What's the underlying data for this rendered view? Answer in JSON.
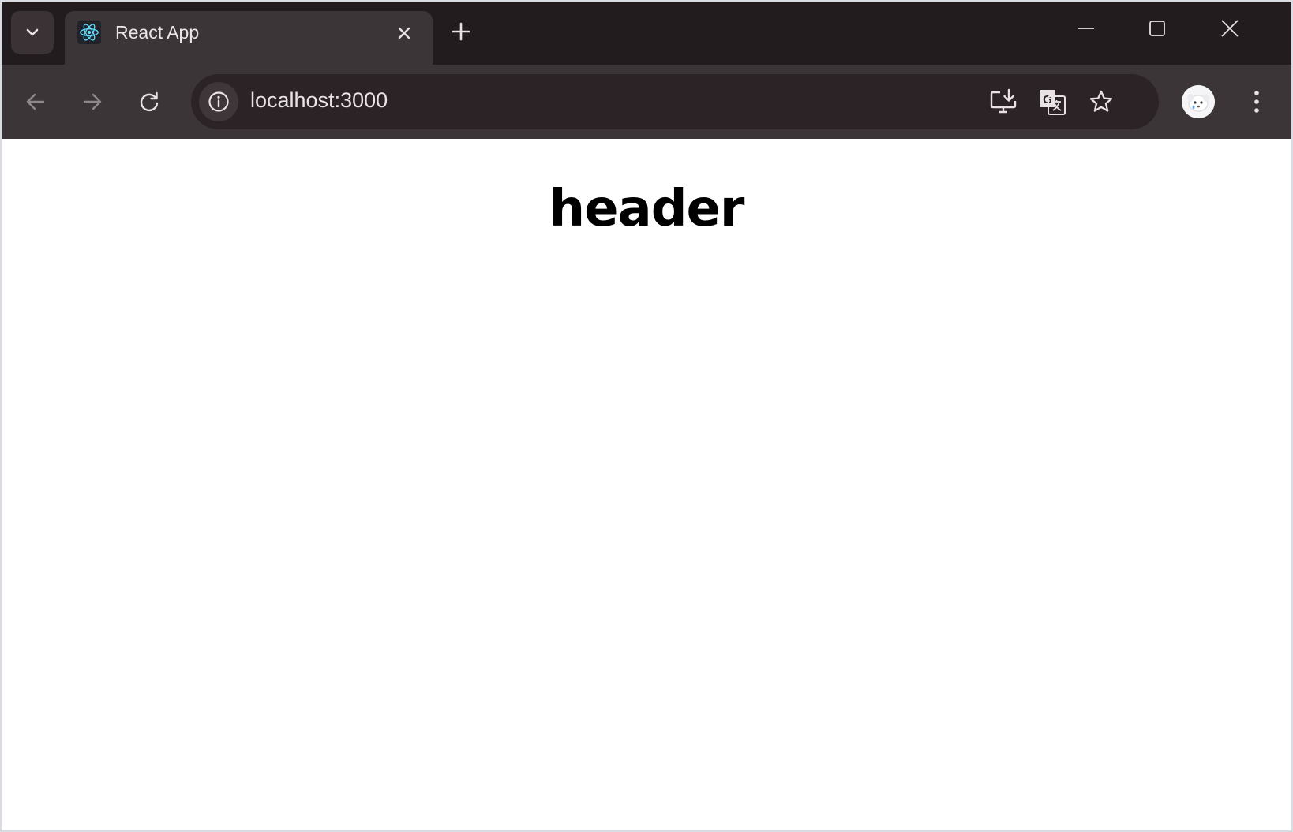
{
  "browser": {
    "tab": {
      "title": "React App",
      "favicon": "react-logo-icon"
    },
    "address_bar": {
      "url": "localhost:3000"
    },
    "icons": {
      "tab_search": "chevron-down-icon",
      "tab_close": "close-icon",
      "new_tab": "plus-icon",
      "minimize": "minimize-icon",
      "maximize": "maximize-icon",
      "close_window": "close-icon",
      "back": "arrow-left-icon",
      "forward": "arrow-right-icon",
      "reload": "reload-icon",
      "site_info": "info-icon",
      "install_app": "install-icon",
      "translate": "translate-icon",
      "bookmark": "star-icon",
      "profile": "avatar",
      "menu": "kebab-menu-icon"
    },
    "colors": {
      "frame": "#231c1f",
      "toolbar": "#3c3537",
      "omnibox": "#2b2326",
      "react_blue": "#61dafb"
    }
  },
  "page": {
    "header": "header"
  }
}
